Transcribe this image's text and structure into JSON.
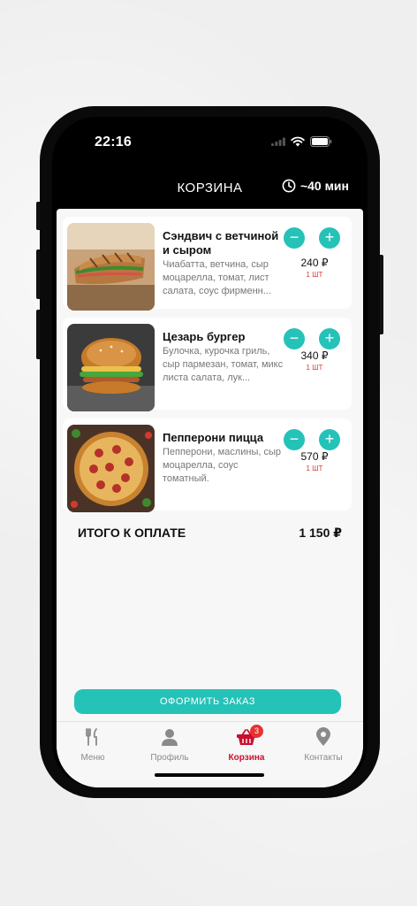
{
  "status_bar": {
    "time": "22:16"
  },
  "header": {
    "title": "КОРЗИНА",
    "delivery_time": "~40 мин"
  },
  "cart": {
    "items": [
      {
        "title": "Сэндвич с ветчиной и сыром",
        "description": "Чиабатта, ветчина, сыр моцарелла, томат, лист салата, соус фирменн...",
        "price": "240 ₽",
        "qty": "1 ШТ",
        "minus": "−",
        "plus": "+"
      },
      {
        "title": "Цезарь бургер",
        "description": "Булочка, курочка гриль, сыр пармезан, томат, микс листа салата, лук...",
        "price": "340 ₽",
        "qty": "1 ШТ",
        "minus": "−",
        "plus": "+"
      },
      {
        "title": "Пепперони пицца",
        "description": "Пепперони, маслины, сыр моцарелла, соус томатный.",
        "price": "570 ₽",
        "qty": "1 ШТ",
        "minus": "−",
        "plus": "+"
      }
    ],
    "total_label": "ИТОГО К ОПЛАТЕ",
    "total_value": "1 150 ₽",
    "order_button": "ОФОРМИТЬ ЗАКАЗ"
  },
  "tabbar": {
    "tabs": [
      {
        "label": "Меню",
        "icon": "fork-knife-icon"
      },
      {
        "label": "Профиль",
        "icon": "person-icon"
      },
      {
        "label": "Корзина",
        "icon": "basket-icon",
        "badge": "3"
      },
      {
        "label": "Контакты",
        "icon": "map-pin-icon"
      }
    ]
  },
  "colors": {
    "accent": "#25c2b8",
    "active_tab": "#c8102e",
    "badge": "#e63232"
  }
}
